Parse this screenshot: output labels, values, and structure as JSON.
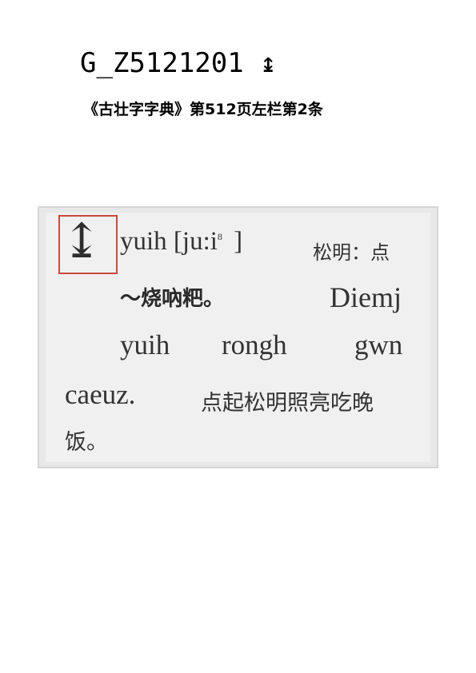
{
  "document": {
    "title": "G_Z5121201 ↨",
    "source": "《古壮字字典》第512页左栏第2条"
  },
  "entry": {
    "headword": "↨",
    "line1_latin": "yuih [ju:i",
    "line1_tone": "8",
    "line1_bracket": "]",
    "line1_gloss": "松明：点",
    "line2_example": "～烧吶粑。",
    "line2_latin": "Diemj",
    "line3_a": "yuih",
    "line3_b": "rongh",
    "line3_c": "gwn",
    "line4_latin": "caeuz.",
    "line4_gloss": "点起松明照亮吃晚",
    "line5_gloss": "饭。"
  }
}
